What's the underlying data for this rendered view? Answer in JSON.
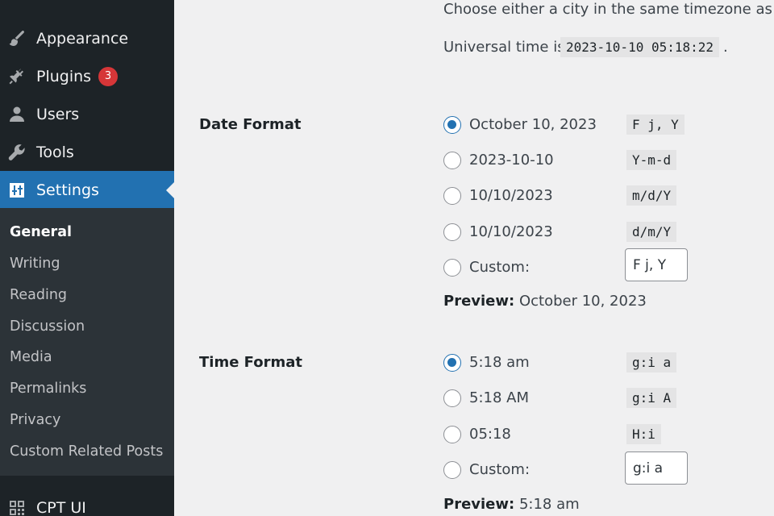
{
  "sidebar": {
    "menu": [
      {
        "label": "Appearance",
        "icon": "paintbrush-icon"
      },
      {
        "label": "Plugins",
        "icon": "plug-icon",
        "badge": "3"
      },
      {
        "label": "Users",
        "icon": "user-icon"
      },
      {
        "label": "Tools",
        "icon": "wrench-icon"
      },
      {
        "label": "Settings",
        "icon": "settings-icon",
        "active": true
      }
    ],
    "submenu": [
      "General",
      "Writing",
      "Reading",
      "Discussion",
      "Media",
      "Permalinks",
      "Privacy",
      "Custom Related Posts"
    ],
    "bottom_item": {
      "label": "CPT UI",
      "icon": "cpt-ui-icon"
    }
  },
  "timezone": {
    "hint": "Choose either a city in the same timezone as you",
    "utc_prefix": "Universal time is",
    "utc_value": "2023-10-10 05:18:22",
    "utc_suffix": "."
  },
  "date_format": {
    "label": "Date Format",
    "options": [
      {
        "display": "October 10, 2023",
        "code": "F j, Y",
        "checked": true
      },
      {
        "display": "2023-10-10",
        "code": "Y-m-d",
        "checked": false
      },
      {
        "display": "10/10/2023",
        "code": "m/d/Y",
        "checked": false
      },
      {
        "display": "10/10/2023",
        "code": "d/m/Y",
        "checked": false
      }
    ],
    "custom_label": "Custom:",
    "custom_value": "F j, Y",
    "preview_label": "Preview:",
    "preview_value": "October 10, 2023"
  },
  "time_format": {
    "label": "Time Format",
    "options": [
      {
        "display": "5:18 am",
        "code": "g:i a",
        "checked": true
      },
      {
        "display": "5:18 AM",
        "code": "g:i A",
        "checked": false
      },
      {
        "display": "05:18",
        "code": "H:i",
        "checked": false
      }
    ],
    "custom_label": "Custom:",
    "custom_value": "g:i a",
    "preview_label": "Preview:",
    "preview_value": "5:18 am"
  },
  "colors": {
    "sidebar_bg": "#1d2327",
    "submenu_bg": "#2c3338",
    "accent": "#2271b1",
    "badge": "#d63638",
    "content_bg": "#f0f0f1"
  }
}
